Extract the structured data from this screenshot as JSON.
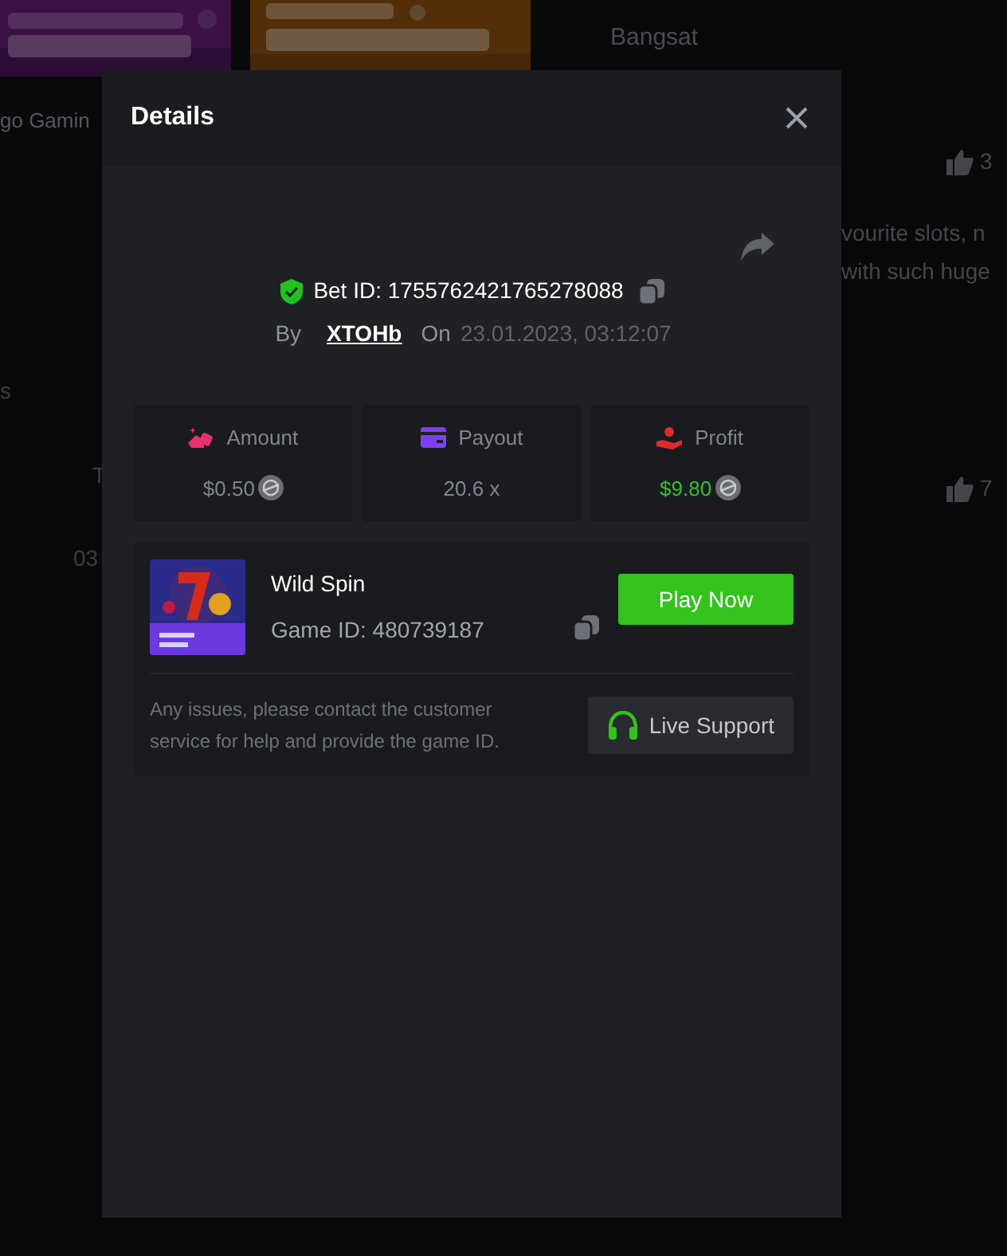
{
  "background": {
    "username": "Bangsat",
    "provider": "go Gamin",
    "fragments": [
      "s",
      "T",
      "03"
    ],
    "comments": [
      {
        "lines": [
          "vourite slots, n",
          "with such huge"
        ],
        "likes": "3"
      },
      {
        "likes": "7"
      }
    ]
  },
  "modal": {
    "title": "Details",
    "bet": {
      "verified": true,
      "bet_id_label": "Bet ID:",
      "bet_id": "1755762421765278088",
      "by_label": "By",
      "user": "XTOHb",
      "on_label": "On",
      "date": "23.01.2023, 03:12:07"
    },
    "stats": [
      {
        "kind": "amount",
        "label": "Amount",
        "value": "$0.50",
        "coin": true,
        "positive": false
      },
      {
        "kind": "payout",
        "label": "Payout",
        "value": "20.6 x",
        "coin": false,
        "positive": false
      },
      {
        "kind": "profit",
        "label": "Profit",
        "value": "$9.80",
        "coin": true,
        "positive": true
      }
    ],
    "game": {
      "name": "Wild Spin",
      "id_label": "Game ID:",
      "id": "480739187",
      "play_button": "Play Now"
    },
    "support": {
      "note": "Any issues, please contact the customer service for help and provide the game ID.",
      "button": "Live Support"
    }
  }
}
